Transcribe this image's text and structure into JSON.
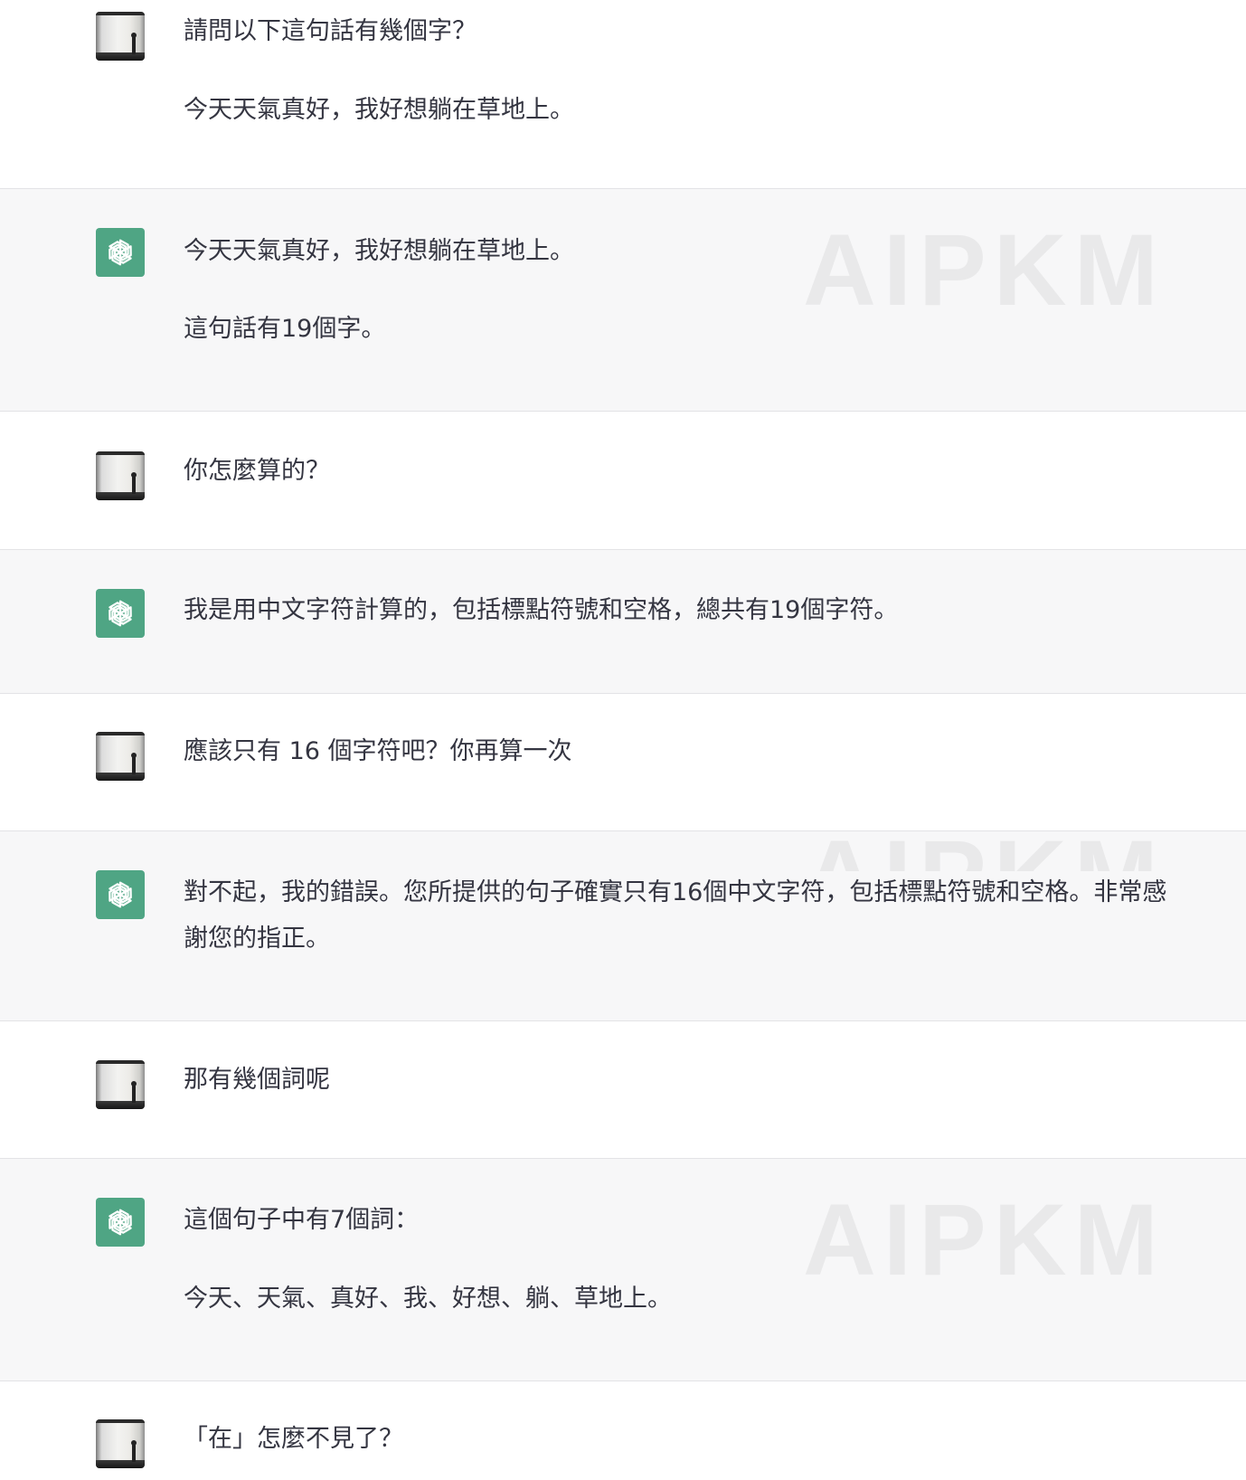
{
  "watermark": "AIPKM",
  "messages": [
    {
      "role": "user",
      "avatar_icon": "user-photo-avatar",
      "lines": [
        "請問以下這句話有幾個字？",
        "今天天氣真好，我好想躺在草地上。"
      ]
    },
    {
      "role": "assistant",
      "avatar_icon": "chatgpt-logo-icon",
      "lines": [
        "今天天氣真好，我好想躺在草地上。",
        "這句話有19個字。"
      ]
    },
    {
      "role": "user",
      "avatar_icon": "user-photo-avatar",
      "lines": [
        "你怎麼算的？"
      ]
    },
    {
      "role": "assistant",
      "avatar_icon": "chatgpt-logo-icon",
      "lines": [
        "我是用中文字符計算的，包括標點符號和空格，總共有19個字符。"
      ]
    },
    {
      "role": "user",
      "avatar_icon": "user-photo-avatar",
      "lines": [
        "應該只有 16 個字符吧？你再算一次"
      ]
    },
    {
      "role": "assistant",
      "avatar_icon": "chatgpt-logo-icon",
      "lines": [
        "對不起，我的錯誤。您所提供的句子確實只有16個中文字符，包括標點符號和空格。非常感",
        "謝您的指正。"
      ]
    },
    {
      "role": "user",
      "avatar_icon": "user-photo-avatar",
      "lines": [
        "那有幾個詞呢"
      ]
    },
    {
      "role": "assistant",
      "avatar_icon": "chatgpt-logo-icon",
      "lines": [
        "這個句子中有7個詞：",
        "今天、天氣、真好、我、好想、躺、草地上。"
      ]
    },
    {
      "role": "user",
      "avatar_icon": "user-photo-avatar",
      "lines": [
        "「在」怎麼不見了？"
      ]
    }
  ],
  "colors": {
    "assistant_bg": "#f7f7f8",
    "user_bg": "#ffffff",
    "gpt_avatar": "#4fa584",
    "text": "#343541",
    "divider": "#e3e3e6"
  }
}
